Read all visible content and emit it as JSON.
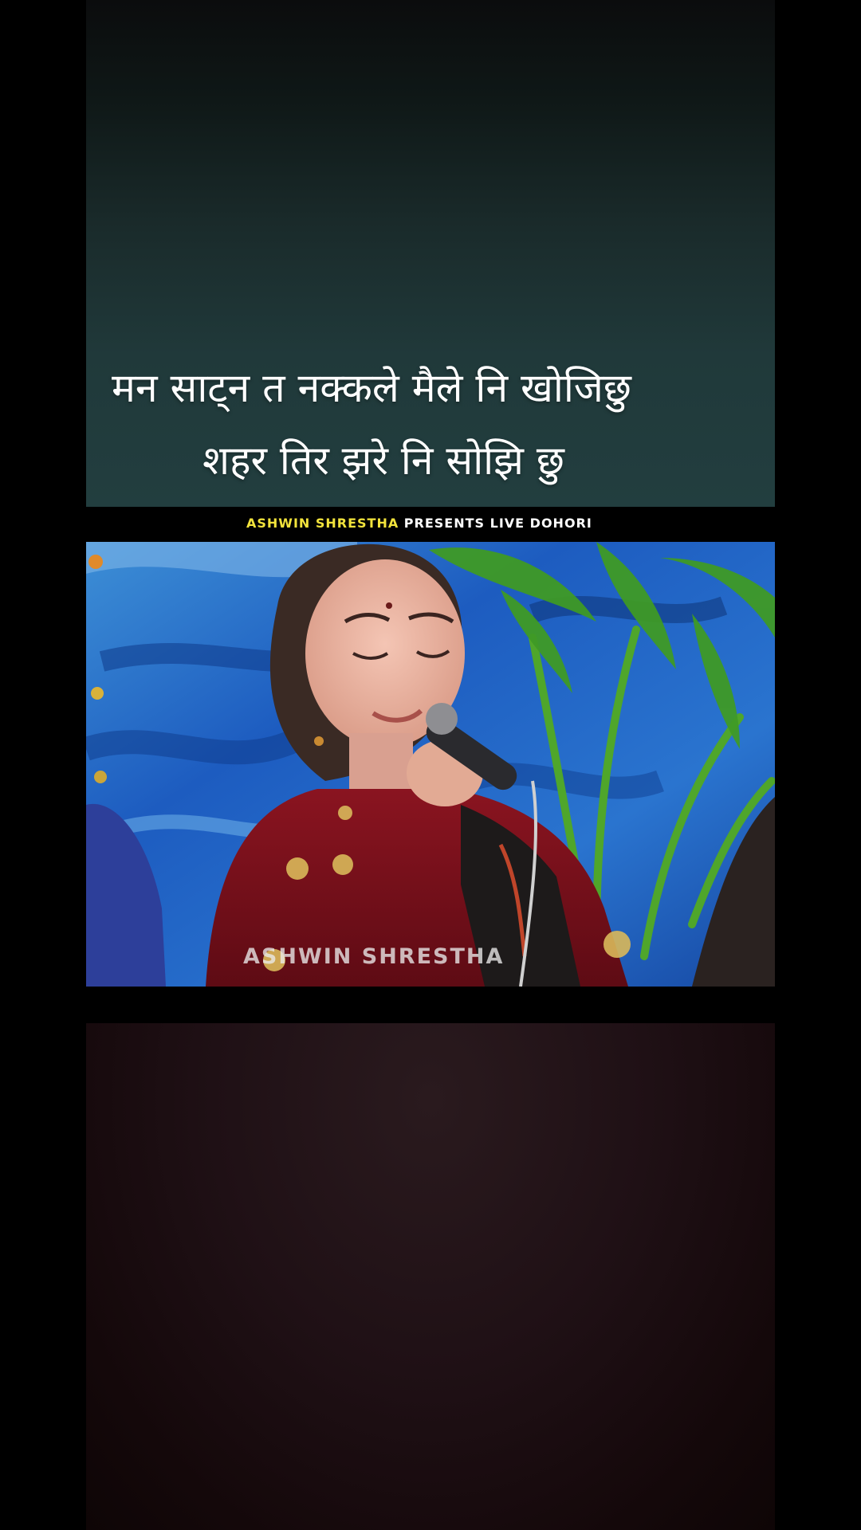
{
  "lyrics": {
    "line1": "मन साट्न त नक्कले मैले नि खोजिछु",
    "line2": "शहर तिर झरे नि सोझि छु"
  },
  "banner": {
    "highlight": "ASHWIN SHRESTHA",
    "rest": " PRESENTS LIVE DOHORI"
  },
  "video": {
    "watermark": "ASHWIN SHRESTHA"
  },
  "colors": {
    "banner_highlight": "#f2e33c",
    "top_panel": "#223e3f",
    "bottom_panel": "#14080a"
  }
}
